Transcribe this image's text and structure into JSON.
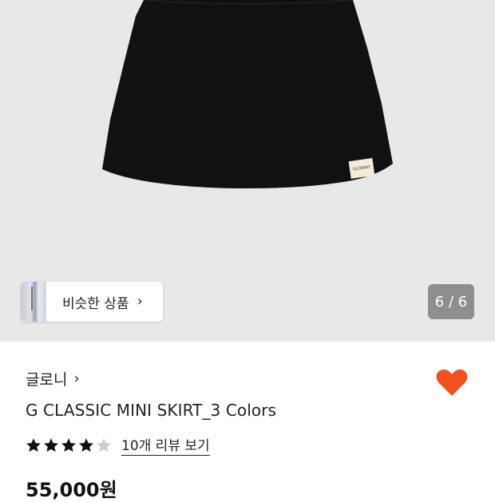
{
  "gallery": {
    "similar_label": "비슷한 상품",
    "counter": "6 / 6",
    "label_tag_text": "GLOWNY"
  },
  "product": {
    "brand": "글로니",
    "title": "G CLASSIC MINI SKIRT_3 Colors",
    "rating": 4,
    "rating_max": 5,
    "reviews_link": "10개 리뷰 보기",
    "price": "55,000원",
    "favorited": true
  },
  "colors": {
    "gallery_bg": "#e8e8e8",
    "heart": "#f4511e",
    "star_filled": "#111111",
    "star_empty": "#cccccc",
    "counter_bg": "#8e8e8e"
  },
  "icons": [
    "chevron-right-icon",
    "heart-icon",
    "star-icon"
  ]
}
